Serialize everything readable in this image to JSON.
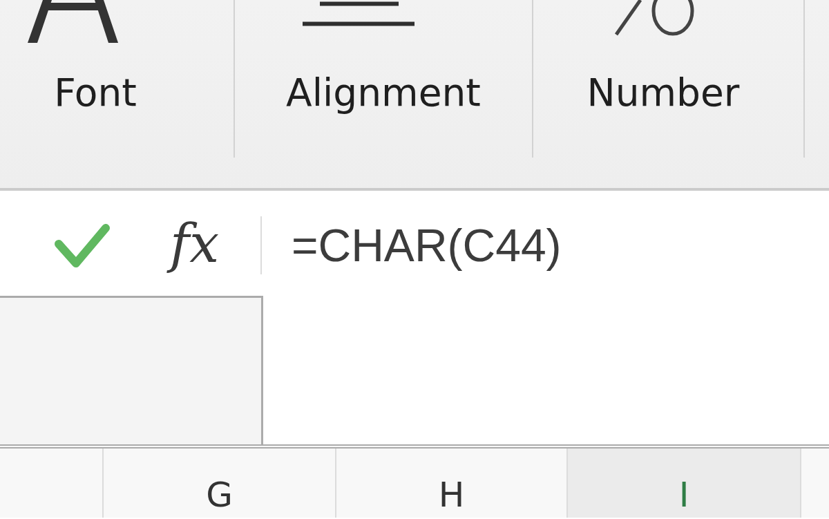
{
  "ribbon": {
    "groups": [
      {
        "kind": "font",
        "label": "Font"
      },
      {
        "kind": "alignment",
        "label": "Alignment"
      },
      {
        "kind": "number",
        "label": "Number"
      }
    ]
  },
  "formula_bar": {
    "function_button": "fx",
    "formula": "=CHAR(C44)"
  },
  "column_headers": [
    {
      "label": "G",
      "selected": false
    },
    {
      "label": "H",
      "selected": false
    },
    {
      "label": "I",
      "selected": true
    }
  ]
}
